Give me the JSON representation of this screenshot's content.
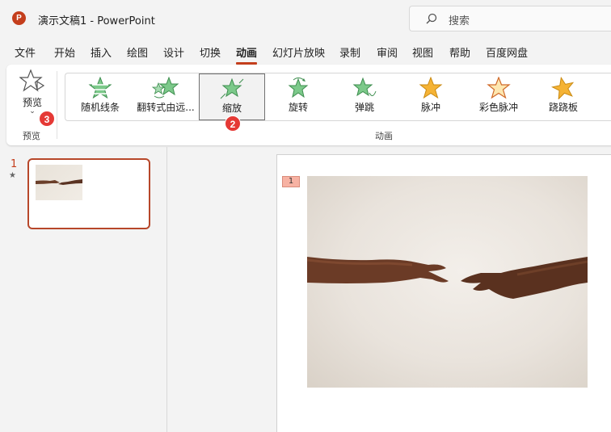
{
  "app": {
    "doc_title": "演示文稿1  -  PowerPoint",
    "logo_letter": "P",
    "search_placeholder": "搜索"
  },
  "menu": {
    "tabs": [
      "文件",
      "开始",
      "插入",
      "绘图",
      "设计",
      "切换",
      "动画",
      "幻灯片放映",
      "录制",
      "审阅",
      "视图",
      "帮助",
      "百度网盘"
    ],
    "active_tab": "动画"
  },
  "ribbon": {
    "preview": {
      "button_label": "预览",
      "group_label": "预览"
    },
    "animation_group_label": "动画",
    "animations": [
      {
        "label": "随机线条",
        "icon": "random-bars-star-icon"
      },
      {
        "label": "翻转式由远...",
        "icon": "float-in-star-icon"
      },
      {
        "label": "缩放",
        "icon": "zoom-star-icon",
        "selected": true
      },
      {
        "label": "旋转",
        "icon": "spin-star-icon"
      },
      {
        "label": "弹跳",
        "icon": "bounce-star-icon"
      },
      {
        "label": "脉冲",
        "icon": "pulse-star-icon"
      },
      {
        "label": "彩色脉冲",
        "icon": "color-pulse-star-icon"
      },
      {
        "label": "跷跷板",
        "icon": "teeter-star-icon"
      }
    ]
  },
  "badges": [
    "1",
    "2",
    "3"
  ],
  "slides_pane": {
    "slide_number": "1",
    "animation_marker": "★"
  },
  "slide": {
    "animation_tag": "1",
    "image": "hands-reaching-photo"
  },
  "colors": {
    "accent": "#c43e1c",
    "entrance_green": "#4caf50",
    "emphasis_gold": "#f5b335",
    "badge_red": "#e53935"
  }
}
